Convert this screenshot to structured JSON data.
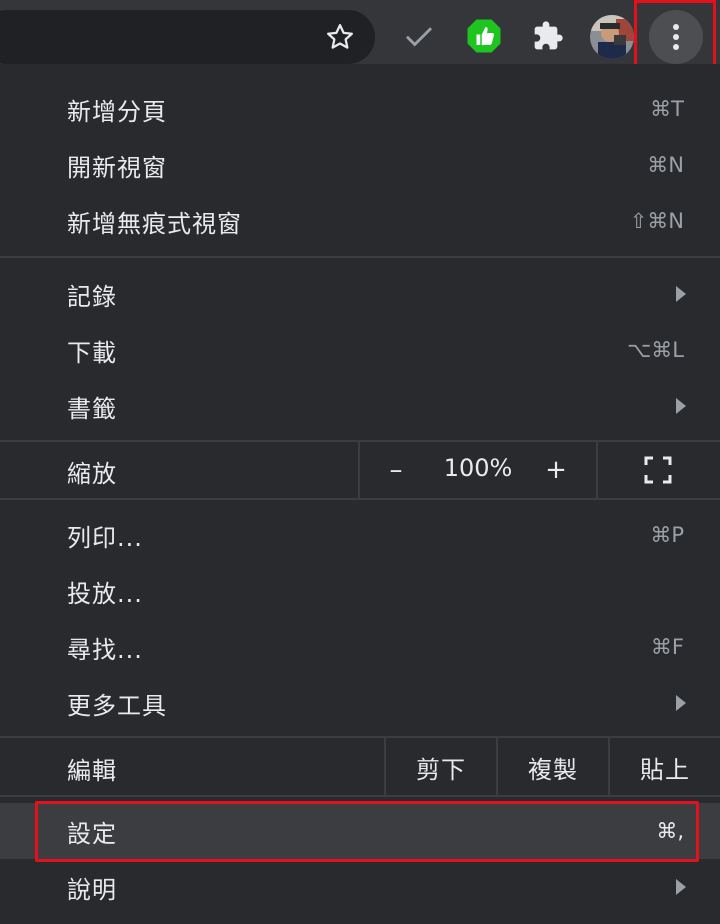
{
  "toolbar": {
    "icons": [
      "bookmark-star-icon",
      "checkmark-icon",
      "thumbs-up-extension-icon",
      "extensions-puzzle-icon",
      "profile-avatar",
      "more-menu-icon"
    ]
  },
  "menu": {
    "group1": [
      {
        "label": "新增分頁",
        "shortcut": "⌘T"
      },
      {
        "label": "開新視窗",
        "shortcut": "⌘N"
      },
      {
        "label": "新增無痕式視窗",
        "shortcut": "⇧⌘N"
      }
    ],
    "group2": [
      {
        "label": "記錄"
      },
      {
        "label": "下載",
        "shortcut": "⌥⌘L"
      },
      {
        "label": "書籤"
      }
    ],
    "zoom": {
      "label": "縮放",
      "minus": "–",
      "value": "100%",
      "plus": "+"
    },
    "group3": [
      {
        "label": "列印...",
        "shortcut": "⌘P"
      },
      {
        "label": "投放..."
      },
      {
        "label": "尋找...",
        "shortcut": "⌘F"
      },
      {
        "label": "更多工具"
      }
    ],
    "edit": {
      "label": "編輯",
      "cut": "剪下",
      "copy": "複製",
      "paste": "貼上"
    },
    "group4": [
      {
        "label": "設定",
        "shortcut": "⌘,"
      },
      {
        "label": "說明"
      }
    ]
  },
  "colors": {
    "highlight_box": "#e2111b",
    "menu_bg": "#292a2d",
    "green_ext": "#1ec51e"
  }
}
